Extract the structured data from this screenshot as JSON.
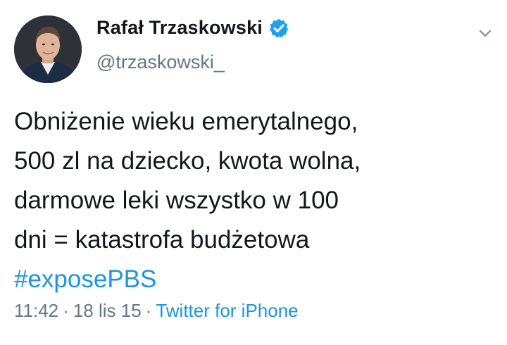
{
  "author": {
    "display_name": "Rafał Trzaskowski",
    "handle": "@trzaskowski_",
    "verified": true,
    "avatar_icon": "profile-photo"
  },
  "tweet": {
    "lines": [
      "Obniżenie wieku emerytalnego,",
      "500 zl na dziecko, kwota wolna,",
      "darmowe leki wszystko w 100",
      "dni = katastrofa budżetowa"
    ],
    "hashtag": "#exposePBS"
  },
  "meta": {
    "time": "11:42",
    "separator": "·",
    "date": "18 lis 15",
    "source": "Twitter for iPhone"
  },
  "menu_icon": "chevron-down-icon",
  "colors": {
    "link": "#1b95e0",
    "secondary_text": "#657786",
    "primary_text": "#14171a",
    "verified_badge": "#1da1f2"
  }
}
